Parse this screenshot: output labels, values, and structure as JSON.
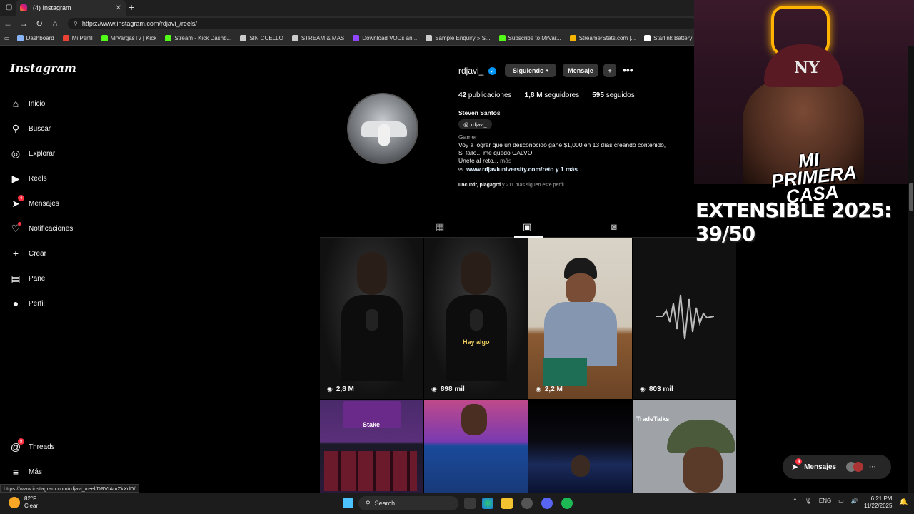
{
  "browser": {
    "tab_title": "(4) Instagram",
    "url": "https://www.instagram.com/rdjavi_/reels/",
    "bookmarks": [
      {
        "label": "Dashboard",
        "icon": "dashboard-icon",
        "color": "#8ab4f8"
      },
      {
        "label": "Mi Perfil",
        "icon": "profile-icon",
        "color": "#ea4335"
      },
      {
        "label": "MrVargasTv | Kick",
        "icon": "kick-icon",
        "color": "#53fc18"
      },
      {
        "label": "Stream - Kick Dashb...",
        "icon": "kick-icon",
        "color": "#53fc18"
      },
      {
        "label": "SIN CUELLO",
        "icon": "folder-icon",
        "color": "#cccccc"
      },
      {
        "label": "STREAM & MAS",
        "icon": "folder-icon",
        "color": "#cccccc"
      },
      {
        "label": "Download VODs an...",
        "icon": "twitch-icon",
        "color": "#9146ff"
      },
      {
        "label": "Sample Enquiry » S...",
        "icon": "globe-icon",
        "color": "#cccccc"
      },
      {
        "label": "Subscribe to MrVar...",
        "icon": "kick-icon",
        "color": "#53fc18"
      },
      {
        "label": "StreamerStats.com |...",
        "icon": "stats-icon",
        "color": "#f5b400"
      },
      {
        "label": "Starlink Battery Pow...",
        "icon": "starlink-icon",
        "color": "#ffffff"
      }
    ]
  },
  "instagram": {
    "logo": "Instagram",
    "nav": [
      {
        "label": "Inicio",
        "icon": "home-icon"
      },
      {
        "label": "Buscar",
        "icon": "search-icon"
      },
      {
        "label": "Explorar",
        "icon": "compass-icon"
      },
      {
        "label": "Reels",
        "icon": "reels-icon"
      },
      {
        "label": "Mensajes",
        "icon": "messenger-icon",
        "badge": "4"
      },
      {
        "label": "Notificaciones",
        "icon": "heart-icon"
      },
      {
        "label": "Crear",
        "icon": "plus-icon"
      },
      {
        "label": "Panel",
        "icon": "panel-icon"
      },
      {
        "label": "Perfil",
        "icon": "avatar-icon"
      }
    ],
    "threads": {
      "label": "Threads",
      "badge": "9"
    },
    "more": {
      "label": "Más"
    }
  },
  "profile": {
    "username": "rdjavi_",
    "following_btn": "Siguiendo",
    "message_btn": "Mensaje",
    "posts": "42",
    "posts_label": "publicaciones",
    "followers": "1,8 M",
    "followers_label": "seguidores",
    "following": "595",
    "following_label": "seguidos",
    "full_name": "Steven Santos",
    "threads_tag": "rdjavi_",
    "category": "Gamer",
    "bio_line1": "Voy a lograr que un desconocido gane $1,000 en 13 días creando contenido,",
    "bio_line2": "Si fallo... me quedo CALVO.",
    "bio_line3": "Unete al reto...",
    "bio_more": "más",
    "link": "www.rdjaviuniversity.com/reto y 1 más",
    "followed_by_names": "uncutdr, plagagrd",
    "followed_by_rest": "y 211 más siguen este perfil"
  },
  "reels": [
    {
      "views": "2,8 M"
    },
    {
      "views": "898 mil",
      "caption": "Hay algo"
    },
    {
      "views": "2,2 M"
    },
    {
      "views": "803 mil"
    }
  ],
  "reels_row2": [
    {
      "label": "Stake"
    },
    {
      "label": ""
    },
    {
      "label": ""
    },
    {
      "label": "TradeTalks"
    }
  ],
  "overlay": {
    "cap_logo": "NY",
    "sign": "MI PRIMERA CASA",
    "banner": "EXTENSIBLE 2025: 39/50"
  },
  "messages_pill": {
    "label": "Mensajes",
    "badge": "4"
  },
  "status_url": "https://www.instagram.com/rdjavi_/reel/DRVfAmZkXdD/",
  "taskbar": {
    "temp": "82°F",
    "weather": "Clear",
    "search": "Search",
    "lang": "ENG",
    "time": "6:21 PM",
    "date": "11/22/2025"
  }
}
